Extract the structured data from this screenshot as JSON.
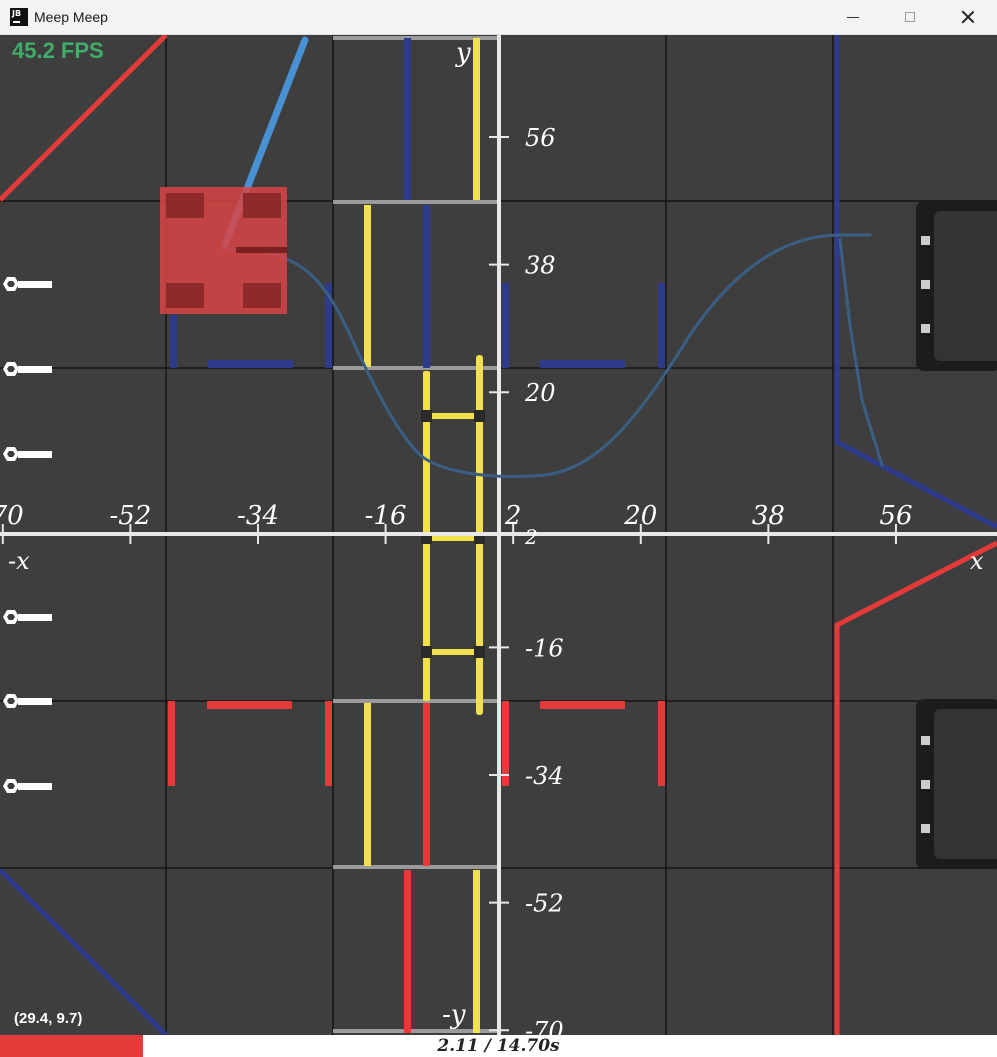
{
  "window": {
    "title": "Meep Meep",
    "icon": "jetbrains-icon",
    "icon_text": "JB",
    "controls": [
      "minimize-icon",
      "maximize-icon",
      "close-icon"
    ]
  },
  "overlay": {
    "fps": "45.2 FPS",
    "cursor_coords": "(29.4, 9.7)"
  },
  "timeline": {
    "label": "2.11 / 14.70s",
    "current_s": 2.11,
    "total_s": 14.7,
    "progress_fraction": 0.1435
  },
  "axes": {
    "x_ticks": [
      "-70",
      "-52",
      "-34",
      "-16",
      "2",
      "20",
      "38",
      "56"
    ],
    "x_tick_values": [
      -70,
      -52,
      -34,
      -16,
      2,
      20,
      38,
      56
    ],
    "y_ticks": [
      "56",
      "38",
      "20",
      "2",
      "-16",
      "-34",
      "-52",
      "-70"
    ],
    "y_tick_values": [
      56,
      38,
      20,
      2,
      -16,
      -34,
      -52,
      -70
    ],
    "x_label": "x",
    "neg_x_label": "-x",
    "y_label": "y",
    "neg_y_label": "-y"
  },
  "colors": {
    "tile": "#3e3e3e",
    "grid": "#151515",
    "axis": "#e8e8e8",
    "red_alliance": "#e53a3a",
    "blue_alliance": "#2e3a8c",
    "yellow_truss": "#f2e14a",
    "robot": "#d94444",
    "path": "#3a5f85",
    "heading": "#4a9be6",
    "fps": "#3fae6a",
    "progress": "#e53a3a"
  }
}
